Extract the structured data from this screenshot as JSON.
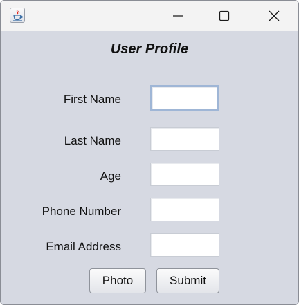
{
  "window": {
    "app_icon": "java-coffee-cup-icon",
    "controls": [
      "minimize-icon",
      "maximize-icon",
      "close-icon"
    ]
  },
  "form": {
    "title": "User Profile",
    "fields": [
      {
        "label": "First Name",
        "value": "",
        "focused": true
      },
      {
        "label": "Last Name",
        "value": ""
      },
      {
        "label": "Age",
        "value": ""
      },
      {
        "label": "Phone Number",
        "value": ""
      },
      {
        "label": "Email Address",
        "value": ""
      }
    ],
    "buttons": {
      "photo": "Photo",
      "submit": "Submit"
    }
  },
  "colors": {
    "window_background": "#d6d9e2",
    "titlebar_background": "#f3f3f3",
    "focus_border": "#9fb6d6"
  }
}
